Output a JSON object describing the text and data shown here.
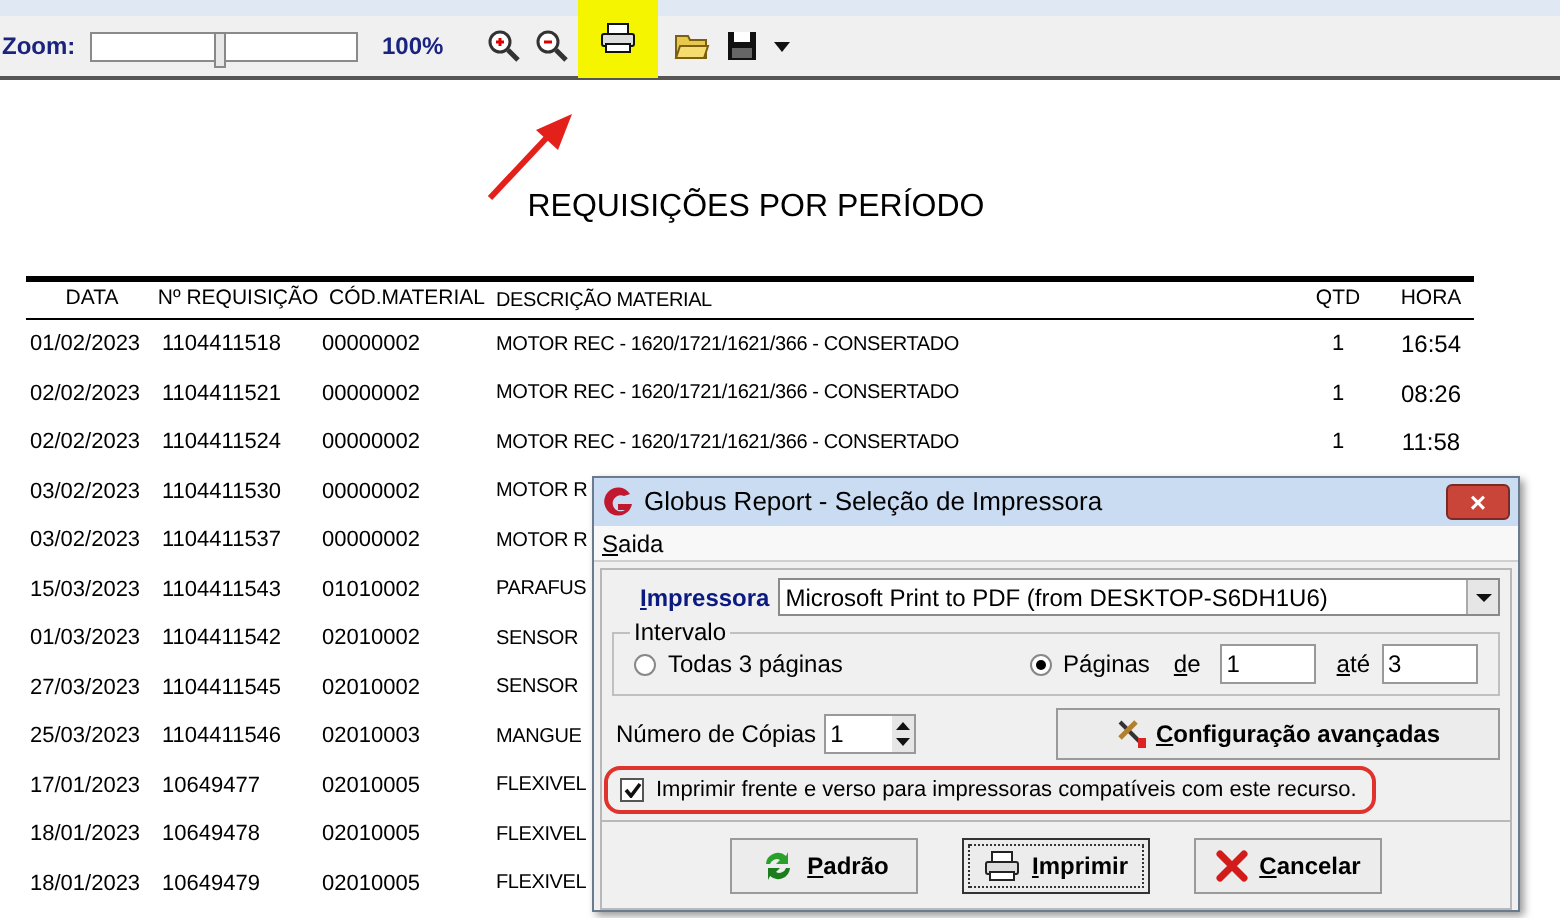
{
  "toolbar": {
    "zoom_label": "Zoom:",
    "zoom_slider": {
      "level": 0.48
    },
    "zoom_value": "100%",
    "print_highlighted": true
  },
  "report": {
    "title": "REQUISIÇÕES POR PERÍODO",
    "columns": [
      "DATA",
      "Nº REQUISIÇÃO",
      "CÓD.MATERIAL",
      "DESCRIÇÃO MATERIAL",
      "QTD",
      "HORA"
    ],
    "rows": [
      {
        "date": "01/02/2023",
        "req": "1104411518",
        "code": "00000002",
        "desc": "MOTOR REC - 1620/1721/1621/366 - CONSERTADO",
        "qtd": "1",
        "hora": "16:54"
      },
      {
        "date": "02/02/2023",
        "req": "1104411521",
        "code": "00000002",
        "desc": "MOTOR REC - 1620/1721/1621/366 - CONSERTADO",
        "qtd": "1",
        "hora": "08:26"
      },
      {
        "date": "02/02/2023",
        "req": "1104411524",
        "code": "00000002",
        "desc": "MOTOR REC - 1620/1721/1621/366 - CONSERTADO",
        "qtd": "1",
        "hora": "11:58"
      },
      {
        "date": "03/02/2023",
        "req": "1104411530",
        "code": "00000002",
        "desc": "MOTOR R"
      },
      {
        "date": "03/02/2023",
        "req": "1104411537",
        "code": "00000002",
        "desc": "MOTOR R"
      },
      {
        "date": "15/03/2023",
        "req": "1104411543",
        "code": "01010002",
        "desc": "PARAFUS"
      },
      {
        "date": "01/03/2023",
        "req": "1104411542",
        "code": "02010002",
        "desc": "SENSOR"
      },
      {
        "date": "27/03/2023",
        "req": "1104411545",
        "code": "02010002",
        "desc": "SENSOR"
      },
      {
        "date": "25/03/2023",
        "req": "1104411546",
        "code": "02010003",
        "desc": "MANGUE"
      },
      {
        "date": "17/01/2023",
        "req": "10649477",
        "code": "02010005",
        "desc": "FLEXIVEL"
      },
      {
        "date": "18/01/2023",
        "req": "10649478",
        "code": "02010005",
        "desc": "FLEXIVEL"
      },
      {
        "date": "18/01/2023",
        "req": "10649479",
        "code": "02010005",
        "desc": "FLEXIVEL"
      }
    ]
  },
  "dialog": {
    "title": "Globus Report - Seleção de Impressora",
    "close": "×",
    "menu": [
      "Saida"
    ],
    "printer_label": "Impressora",
    "printer_value": "Microsoft Print to PDF (from DESKTOP-S6DH1U6)",
    "range_label": "Intervalo",
    "range_options": [
      {
        "label": "Todas 3 páginas",
        "selected": false
      },
      {
        "label": "Páginas",
        "selected": true
      }
    ],
    "from_label": "de",
    "from_value": "1",
    "to_label": "até",
    "to_value": "3",
    "copies_label": "Número de Cópias",
    "copies_value": "1",
    "advanced_button": "Configuração avançadas",
    "duplex": {
      "label": "Imprimir frente e verso para impressoras compatíveis com este recurso.",
      "checked": true,
      "highlighted": true
    },
    "buttons": [
      {
        "kind": "reset",
        "label": "Padrão",
        "default": false
      },
      {
        "kind": "print",
        "label": "Imprimir",
        "default": true
      },
      {
        "kind": "cancel",
        "label": "Cancelar",
        "default": false
      }
    ]
  }
}
